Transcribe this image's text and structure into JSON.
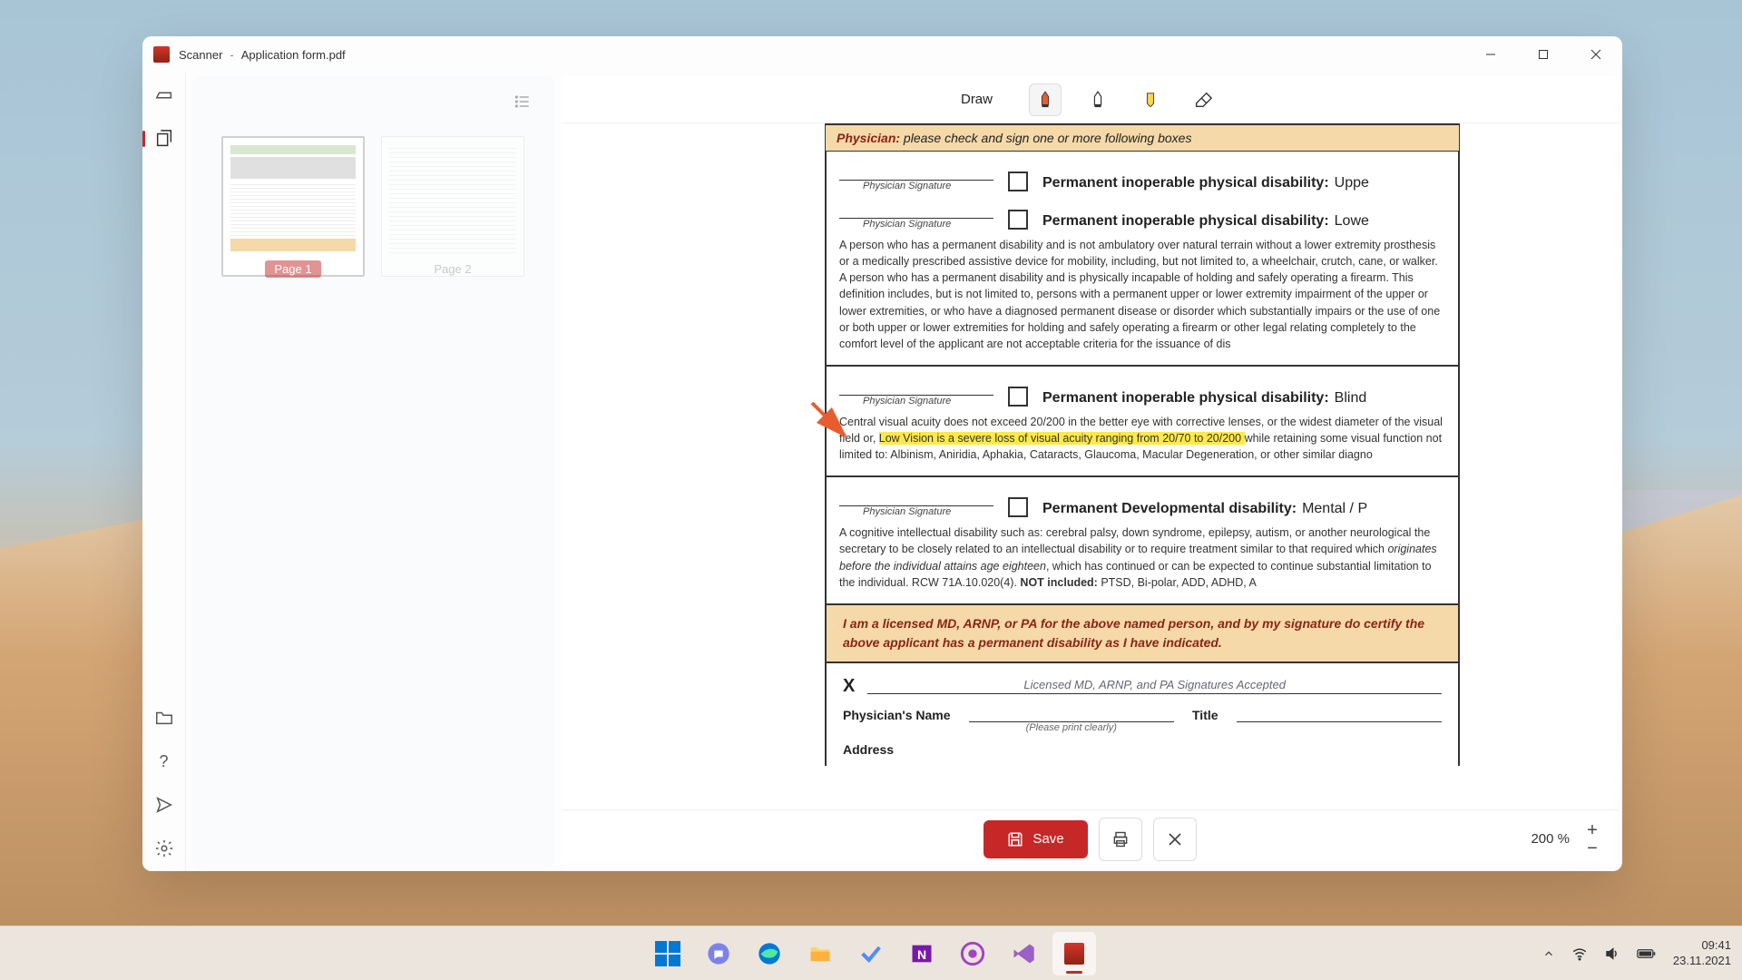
{
  "titlebar": {
    "app": "Scanner",
    "separator": "-",
    "file": "Application form.pdf"
  },
  "thumbnails": {
    "pages": [
      {
        "label": "Page 1",
        "selected": true
      },
      {
        "label": "Page 2",
        "selected": false
      }
    ]
  },
  "toolbar": {
    "draw_label": "Draw"
  },
  "document": {
    "header_prefix": "Physician:",
    "header_rest": "  please check and sign one or more following boxes",
    "sig_label": "Physician  Signature",
    "sections": {
      "s1": {
        "title": "Permanent inoperable physical disability:",
        "suffix": "Uppe"
      },
      "s2": {
        "title": "Permanent inoperable physical disability:",
        "suffix": "Lowe",
        "body": "A person who has a permanent disability and is not ambulatory over natural terrain without a lower extremity prosthesis or a medically prescribed assistive device for mobility, including, but not limited to, a wheelchair, crutch, cane, or walker. A person who has a permanent disability and is physically incapable of holding and safely operating a firearm. This definition includes, but is not limited to, persons with a permanent upper or lower extremity impairment of the upper or lower extremities, or who have a diagnosed permanent disease or disorder which substantially impairs or the use of one or both upper or lower extremities for holding and safely operating a firearm or other legal relating  completely to the comfort level of the applicant are not acceptable criteria for the issuance of dis"
      },
      "s3": {
        "title": "Permanent inoperable physical disability:",
        "suffix": "Blind",
        "pre": "Central visual acuity does not exceed 20/200 in the better eye with corrective lenses, or the widest diameter of the visual field or, ",
        "hl": "Low Vision is a severe loss of visual acuity ranging from 20/70 to 20/200 ",
        "post": "while retaining some visual function not limited to:  Albinism, Aniridia, Aphakia, Cataracts, Glaucoma, Macular Degeneration, or other similar diagno"
      },
      "s4": {
        "title": "Permanent Developmental disability:",
        "suffix": "Mental / P",
        "body_pre": "A cognitive intellectual disability such as: cerebral palsy, down syndrome, epilepsy, autism, or another neurological the secretary to be closely related to an intellectual disability or to require treatment similar to that required which ",
        "body_italic": "originates before the individual attains age eighteen",
        "body_post": ",  which has continued or can be expected to continue substantial limitation to the individual.   RCW 71A.10.020(4).   ",
        "body_bold": "NOT included:",
        "body_tail": "  PTSD, Bi-polar, ADD, ADHD, A"
      }
    },
    "certify": "I am a licensed MD, ARNP, or PA for the above named person, and by my signature do certify the above applicant has a permanent disability as I have indicated.",
    "x": "X",
    "sig_hint": "Licensed  MD,  ARNP,  and   PA   Signatures  Accepted",
    "name_label": "Physician's Name",
    "title_label": "Title",
    "print_clearly": "(Please print clearly)",
    "address_label": "Address"
  },
  "bottom": {
    "save": "Save",
    "zoom": "200 %"
  },
  "tray": {
    "time": "09:41",
    "date": "23.11.2021"
  }
}
